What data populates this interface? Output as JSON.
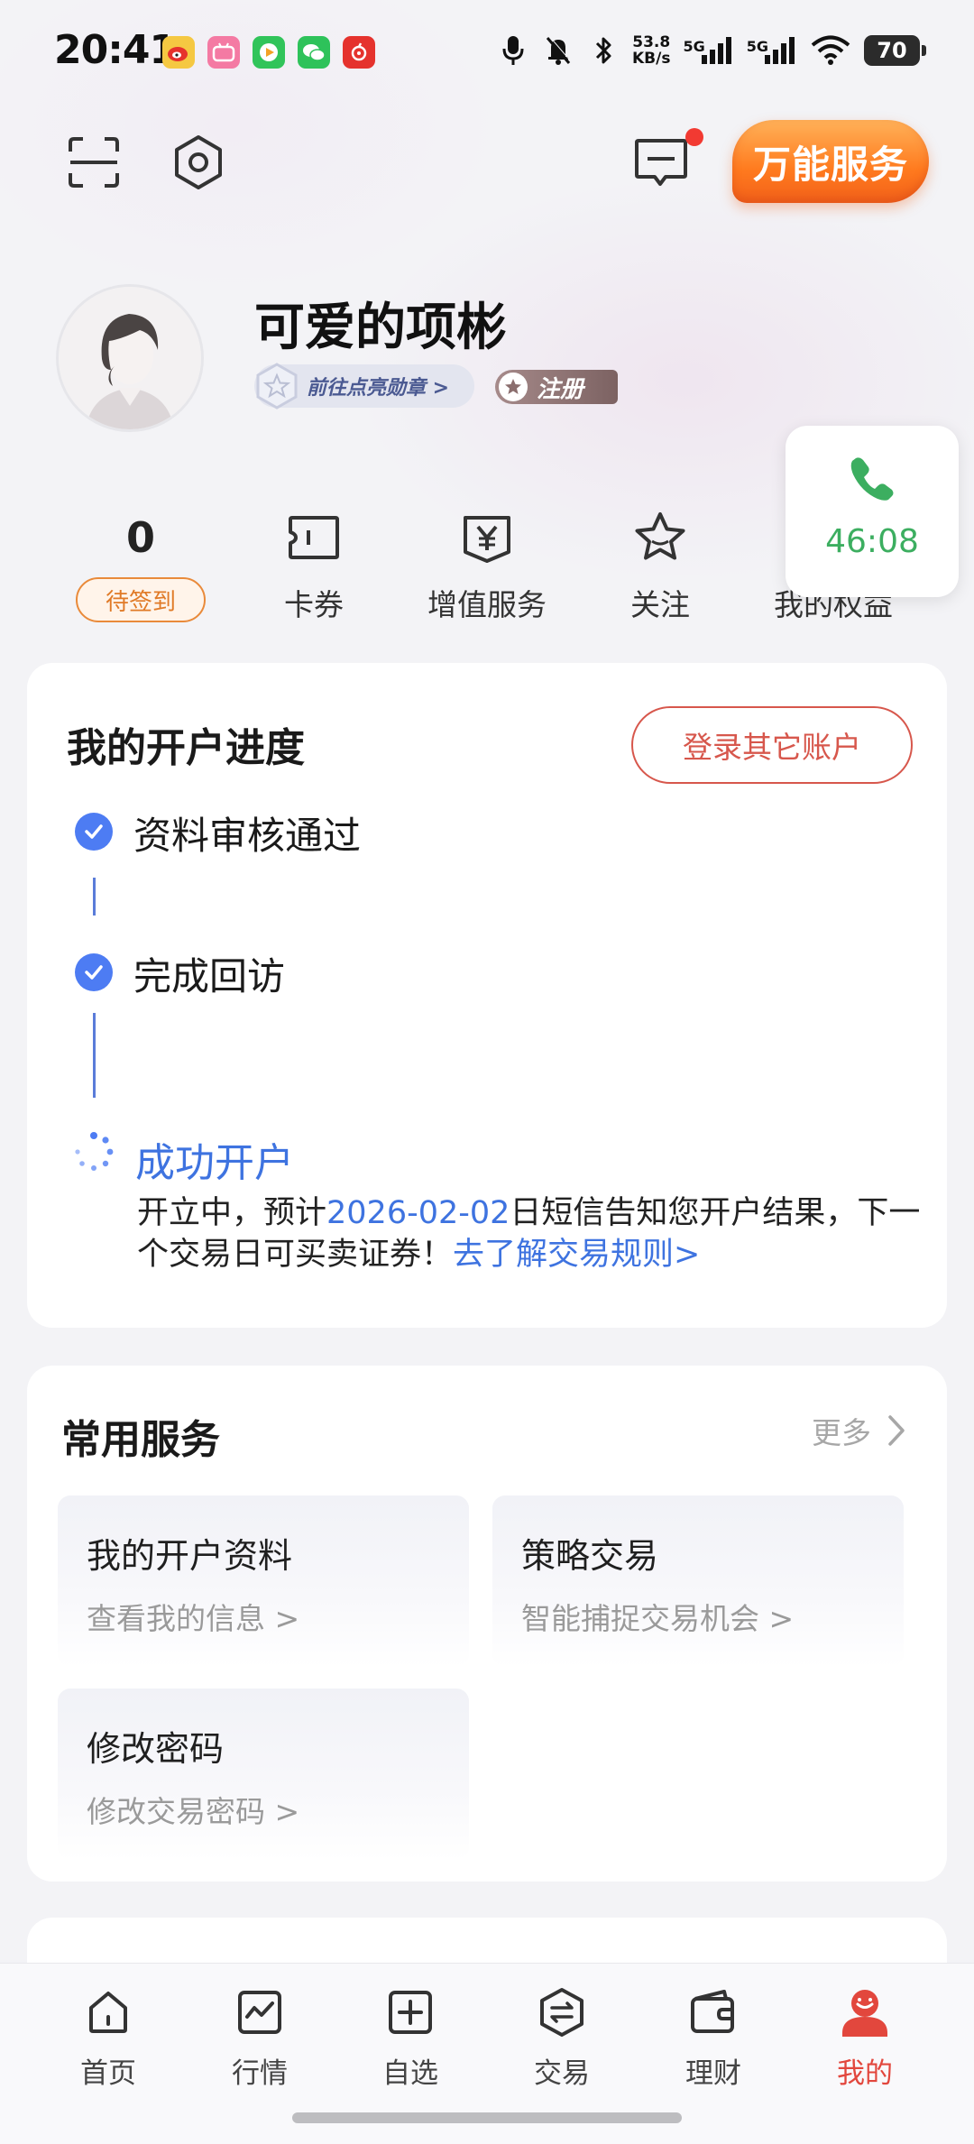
{
  "status_bar": {
    "time": "20:41",
    "netspeed_value": "53.8",
    "netspeed_unit": "KB/s",
    "signal1_label": "5G",
    "signal2_label": "5G",
    "battery": "70",
    "app_icons": [
      "weibo-icon",
      "bilibili-icon",
      "video-app-icon",
      "wechat-icon",
      "netease-music-icon"
    ]
  },
  "header": {
    "scan_icon": "scan-icon",
    "settings_icon": "gear-icon",
    "message_icon": "message-icon",
    "service_button": "万能服务"
  },
  "profile": {
    "name": "可爱的项彬",
    "badge_link": "前往点亮勋章 >",
    "register_tag": "注册"
  },
  "stats": [
    {
      "value": "0",
      "label": "待签到"
    },
    {
      "icon": "coupon-icon",
      "label": "卡券"
    },
    {
      "icon": "yen-icon",
      "label": "增值服务"
    },
    {
      "icon": "star-icon",
      "label": "关注"
    },
    {
      "label": "我的权益"
    }
  ],
  "call": {
    "timer": "46:08",
    "icon": "phone-icon"
  },
  "account_progress": {
    "title": "我的开户进度",
    "login_other": "登录其它账户",
    "steps": [
      {
        "label": "资料审核通过",
        "status": "done"
      },
      {
        "label": "完成回访",
        "status": "done"
      },
      {
        "label": "成功开户",
        "status": "in-progress"
      }
    ],
    "desc_prefix": "开立中，预计",
    "desc_date": "2026-02-02",
    "desc_middle": "日短信告知您开户结果，下一个交易日可买卖证券！",
    "desc_link": "去了解交易规则>"
  },
  "common_services": {
    "title": "常用服务",
    "more": "更多",
    "items": [
      {
        "title": "我的开户资料",
        "subtitle": "查看我的信息 >"
      },
      {
        "title": "策略交易",
        "subtitle": "智能捕捉交易机会 >"
      },
      {
        "title": "修改密码",
        "subtitle": "修改交易密码 >"
      }
    ]
  },
  "bottom_nav": [
    {
      "label": "首页",
      "icon": "home-icon"
    },
    {
      "label": "行情",
      "icon": "chart-icon"
    },
    {
      "label": "自选",
      "icon": "add-square-icon"
    },
    {
      "label": "交易",
      "icon": "exchange-icon"
    },
    {
      "label": "理财",
      "icon": "wallet-icon"
    },
    {
      "label": "我的",
      "icon": "user-icon",
      "active": true
    }
  ],
  "colors": {
    "accent_red": "#e2473d",
    "accent_blue": "#3e73e0",
    "orange": "#ff7a1e",
    "green": "#3cae60"
  }
}
